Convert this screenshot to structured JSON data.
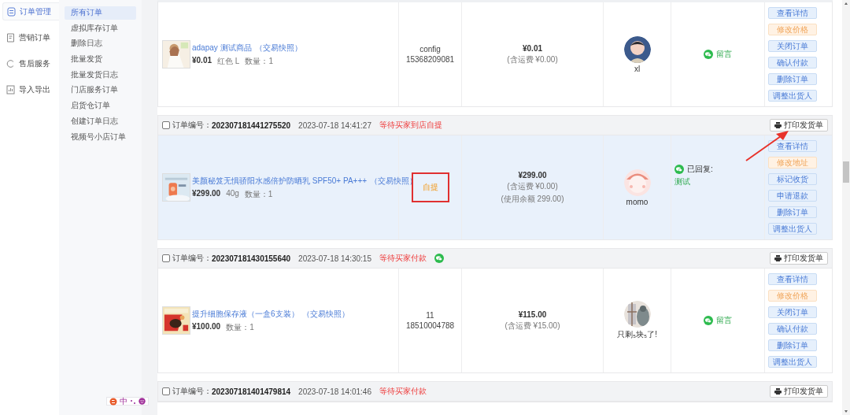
{
  "nav": {
    "items": [
      {
        "label": "订单管理",
        "selected": true
      },
      {
        "label": "营销订单",
        "selected": false
      },
      {
        "label": "售后服务",
        "selected": false
      },
      {
        "label": "导入导出",
        "selected": false
      }
    ]
  },
  "submenu": {
    "items": [
      {
        "label": "所有订单",
        "selected": true
      },
      {
        "label": "虚拟库存订单",
        "selected": false
      },
      {
        "label": "删除日志",
        "selected": false
      },
      {
        "label": "批量发货",
        "selected": false
      },
      {
        "label": "批量发货日志",
        "selected": false
      },
      {
        "label": "门店服务订单",
        "selected": false
      },
      {
        "label": "启货仓订单",
        "selected": false
      },
      {
        "label": "创建订单日志",
        "selected": false
      },
      {
        "label": "视频号小店订单",
        "selected": false
      }
    ]
  },
  "ime_bar": {
    "label": "中"
  },
  "orders": [
    {
      "highlighted": false,
      "product": {
        "title": "adapay 测试商品",
        "snapshot": "（交易快照）",
        "price": "¥0.01",
        "spec": "红色 L",
        "qty": "数量：1"
      },
      "buyer": {
        "kind": "contact",
        "name": "config",
        "phone": "15368209081"
      },
      "total": {
        "amount": "¥0.01",
        "lines": [
          "(含运费 ¥0.00)"
        ]
      },
      "user": {
        "name": "xl"
      },
      "message": {
        "kind": "note",
        "label": "留言"
      },
      "actions": [
        {
          "label": "查看详情",
          "kind": "primary"
        },
        {
          "label": "修改价格",
          "kind": "warning"
        },
        {
          "label": "关闭订单",
          "kind": "primary"
        },
        {
          "label": "确认付款",
          "kind": "primary"
        },
        {
          "label": "删除订单",
          "kind": "primary"
        },
        {
          "label": "调整出货人",
          "kind": "primary"
        }
      ]
    },
    {
      "highlighted": true,
      "header": {
        "checked": false,
        "label": "订单编号：",
        "number": "202307181441275520",
        "time": "2023-07-18 14:41:27",
        "status": "等待买家到店自提",
        "wechat": false,
        "print": "打印发货单"
      },
      "product": {
        "title": "美颜秘笈无惧骄阳水感倍护防晒乳 SPF50+ PA+++",
        "snapshot": "（交易快照）",
        "price": "¥299.00",
        "spec": "40g",
        "qty": "数量：1"
      },
      "buyer": {
        "kind": "pickup",
        "tag": "自提"
      },
      "total": {
        "amount": "¥299.00",
        "lines": [
          "(含运费 ¥0.00)",
          "(使用余额 299.00)"
        ]
      },
      "user": {
        "name": "momo"
      },
      "message": {
        "kind": "replied",
        "label": "已回复:",
        "text": "测试"
      },
      "actions": [
        {
          "label": "查看详情",
          "kind": "primary"
        },
        {
          "label": "修改地址",
          "kind": "warning"
        },
        {
          "label": "标记收货",
          "kind": "primary"
        },
        {
          "label": "申请退款",
          "kind": "primary"
        },
        {
          "label": "删除订单",
          "kind": "primary"
        },
        {
          "label": "调整出货人",
          "kind": "primary"
        }
      ]
    },
    {
      "highlighted": false,
      "header": {
        "checked": false,
        "label": "订单编号：",
        "number": "202307181430155640",
        "time": "2023-07-18 14:30:15",
        "status": "等待买家付款",
        "wechat": true,
        "print": "打印发货单"
      },
      "product": {
        "title": "提升细胞保存液（一盒6支装）",
        "snapshot": "（交易快照）",
        "price": "¥100.00",
        "qty": "数量：1"
      },
      "buyer": {
        "kind": "contact",
        "name": "11",
        "phone": "18510004788"
      },
      "total": {
        "amount": "¥115.00",
        "lines": [
          "(含运费 ¥15.00)"
        ]
      },
      "user": {
        "name": "只剩₅块₅了!"
      },
      "message": {
        "kind": "note",
        "label": "留言"
      },
      "actions": [
        {
          "label": "查看详情",
          "kind": "primary"
        },
        {
          "label": "修改价格",
          "kind": "warning"
        },
        {
          "label": "关闭订单",
          "kind": "primary"
        },
        {
          "label": "确认付款",
          "kind": "primary"
        },
        {
          "label": "删除订单",
          "kind": "primary"
        },
        {
          "label": "调整出货人",
          "kind": "primary"
        }
      ]
    },
    {
      "header": {
        "checked": false,
        "label": "订单编号：",
        "number": "202307181401479814",
        "time": "2023-07-18 14:01:46",
        "status": "等待买家付款",
        "wechat": false,
        "print": "打印发货单"
      }
    }
  ]
}
